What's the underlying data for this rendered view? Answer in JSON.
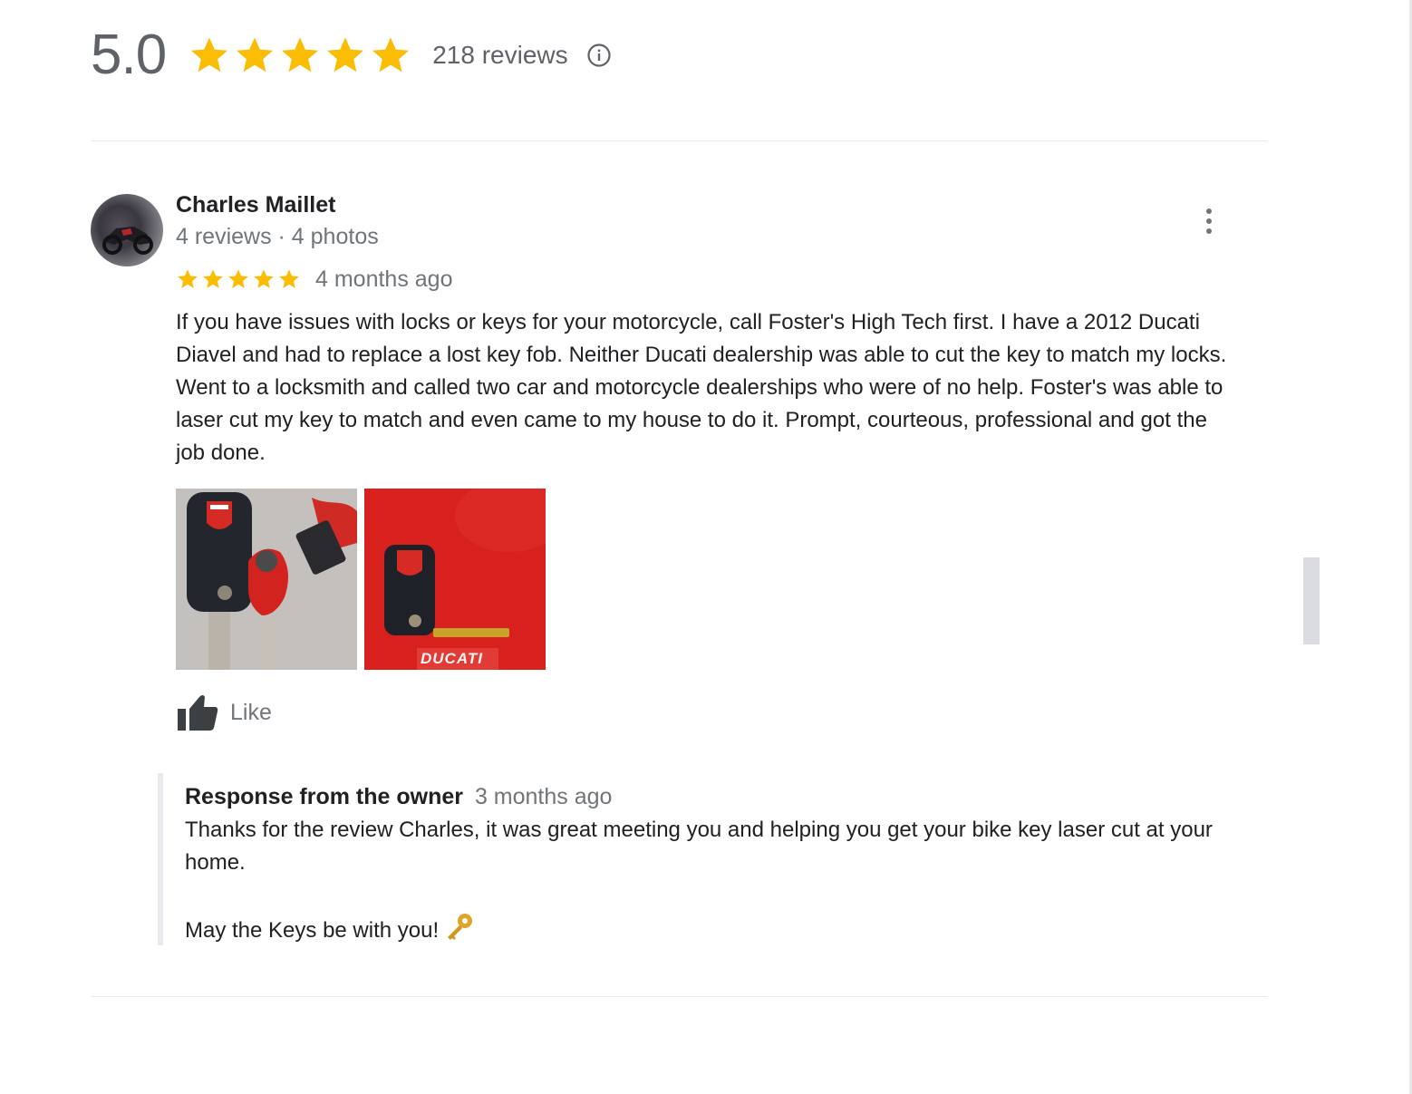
{
  "summary": {
    "score": "5.0",
    "rating": 5,
    "max_rating": 5,
    "review_count": "218 reviews",
    "info_icon": "info-circle-icon"
  },
  "review": {
    "reviewer_name": "Charles Maillet",
    "reviewer_meta": "4 reviews · 4 photos",
    "rating": 5,
    "date": "4 months ago",
    "text": "If you have issues with locks or keys for your motorcycle, call Foster's High Tech first. I have a 2012 Ducati Diavel and had to replace a lost key fob. Neither Ducati dealership was able to cut the key to match my locks. Went to a locksmith and called two car and motorcycle dealerships who were of no help. Foster's was able to laser cut my key to match and even came to my house to do it. Prompt, courteous, professional and got the job done.",
    "photos": [
      {
        "icon": "key-fob-photo",
        "caption": ""
      },
      {
        "icon": "ducati-key-photo",
        "caption": "DUCATI"
      }
    ],
    "like_label": "Like",
    "more_icon": "more-vert-icon"
  },
  "owner_response": {
    "title": "Response from the owner",
    "date": "3 months ago",
    "line1": "Thanks for the review Charles, it was great meeting you and helping you get your bike key laser cut at your home.",
    "line2": "May the Keys be with you!",
    "emoji": "key-icon"
  },
  "colors": {
    "star": "#fbbc04",
    "muted_text": "#70757a",
    "divider": "#e8eaed"
  }
}
